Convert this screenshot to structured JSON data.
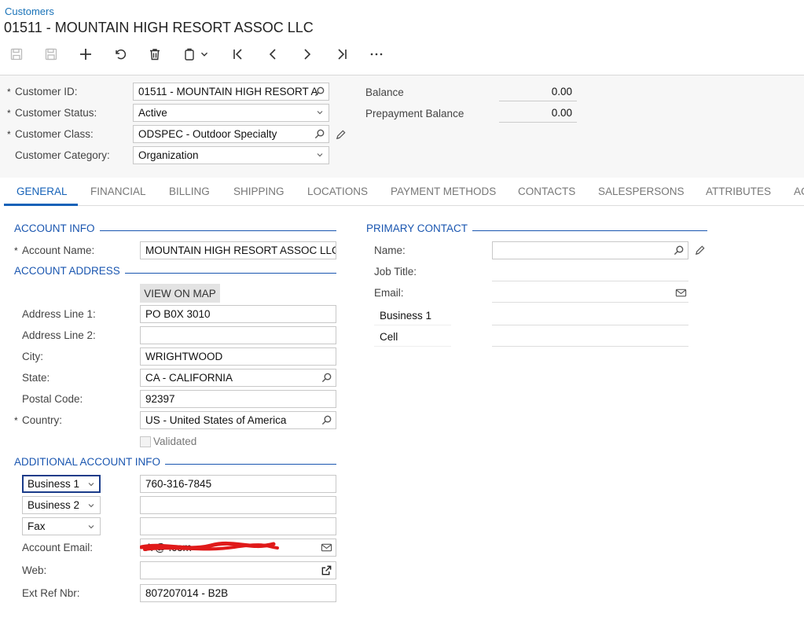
{
  "header": {
    "breadcrumb": "Customers",
    "title": "01511 - MOUNTAIN HIGH RESORT ASSOC LLC"
  },
  "toolbar": {
    "buttons": [
      "save-icon",
      "save-close-icon",
      "add-icon",
      "undo-icon",
      "delete-icon",
      "copy-icon",
      "chevron-down-icon",
      "first-icon",
      "prev-icon",
      "next-icon",
      "last-icon",
      "more-icon"
    ]
  },
  "summary": {
    "customer_id_label": "Customer ID:",
    "customer_id_value": "01511 - MOUNTAIN HIGH RESORT A",
    "customer_status_label": "Customer Status:",
    "customer_status_value": "Active",
    "customer_class_label": "Customer Class:",
    "customer_class_value": "ODSPEC - Outdoor Specialty",
    "customer_category_label": "Customer Category:",
    "customer_category_value": "Organization",
    "balance_label": "Balance",
    "balance_value": "0.00",
    "prepayment_label": "Prepayment Balance",
    "prepayment_value": "0.00"
  },
  "tabs": [
    "GENERAL",
    "FINANCIAL",
    "BILLING",
    "SHIPPING",
    "LOCATIONS",
    "PAYMENT METHODS",
    "CONTACTS",
    "SALESPERSONS",
    "ATTRIBUTES",
    "AC"
  ],
  "account_info": {
    "title": "ACCOUNT INFO",
    "account_name_label": "Account Name:",
    "account_name_value": "MOUNTAIN HIGH RESORT ASSOC LLC"
  },
  "account_address": {
    "title": "ACCOUNT ADDRESS",
    "view_on_map": "VIEW ON MAP",
    "address1_label": "Address Line 1:",
    "address1_value": "PO B0X 3010",
    "address2_label": "Address Line 2:",
    "address2_value": "",
    "city_label": "City:",
    "city_value": "WRIGHTWOOD",
    "state_label": "State:",
    "state_value": "CA - CALIFORNIA",
    "postal_label": "Postal Code:",
    "postal_value": "92397",
    "country_label": "Country:",
    "country_value": "US - United States of America",
    "validated_label": "Validated"
  },
  "additional_info": {
    "title": "ADDITIONAL ACCOUNT INFO",
    "phone1_type": "Business 1",
    "phone1_value": "760-316-7845",
    "phone2_type": "Business 2",
    "phone2_value": "",
    "fax_type": "Fax",
    "fax_value": "",
    "email_label": "Account Email:",
    "email_value": "A                          @        .com",
    "web_label": "Web:",
    "web_value": "",
    "ext_ref_label": "Ext Ref Nbr:",
    "ext_ref_value": "807207014 - B2B"
  },
  "primary_contact": {
    "title": "PRIMARY CONTACT",
    "name_label": "Name:",
    "job_title_label": "Job Title:",
    "email_label": "Email:",
    "business1_label": "Business 1",
    "cell_label": "Cell"
  },
  "colors": {
    "accent": "#1662b8",
    "section": "#1a56b0",
    "redaction": "#e01a1a"
  }
}
